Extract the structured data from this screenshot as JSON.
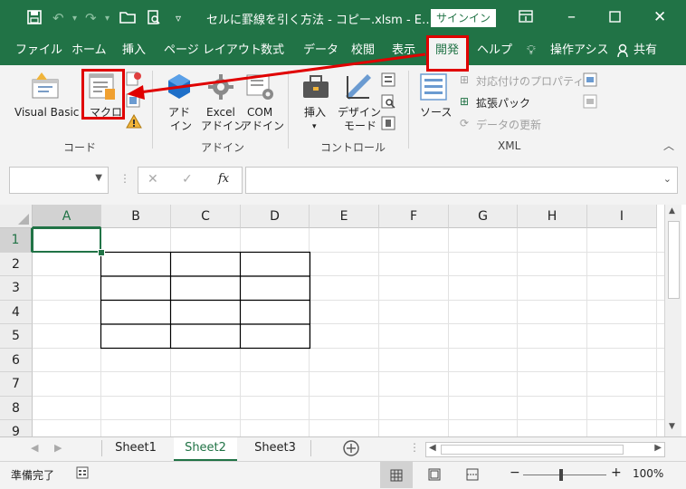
{
  "titlebar": {
    "title": "セルに罫線を引く方法 - コピー.xlsm  -  E…",
    "signin_label": "サインイン"
  },
  "tabs": [
    {
      "label": "ファイル"
    },
    {
      "label": "ホーム"
    },
    {
      "label": "挿入"
    },
    {
      "label": "ページ レイアウト"
    },
    {
      "label": "数式"
    },
    {
      "label": "データ"
    },
    {
      "label": "校閲"
    },
    {
      "label": "表示"
    },
    {
      "label": "開発"
    },
    {
      "label": "ヘルプ"
    }
  ],
  "tellme": "操作アシス",
  "share": "共有",
  "ribbon": {
    "code": {
      "label": "コード",
      "visual_basic": "Visual Basic",
      "macro": "マクロ"
    },
    "addins": {
      "label": "アドイン",
      "addin_1": "アド",
      "addin_2": "イン",
      "excel_1": "Excel",
      "excel_2": "アドイン",
      "com_1": "COM",
      "com_2": "アドイン"
    },
    "controls": {
      "label": "コントロール",
      "insert": "挿入",
      "design_1": "デザイン",
      "design_2": "モード"
    },
    "xml": {
      "label": "XML",
      "source": "ソース",
      "map_properties": "対応付けのプロパティ",
      "expansion_pack": "拡張パック",
      "refresh_data": "データの更新"
    }
  },
  "formula": {
    "fx": "fx"
  },
  "grid": {
    "columns": [
      "A",
      "B",
      "C",
      "D",
      "E",
      "F",
      "G",
      "H",
      "I"
    ],
    "rows": [
      "1",
      "2",
      "3",
      "4",
      "5",
      "6",
      "7",
      "8",
      "9"
    ]
  },
  "sheets": [
    {
      "label": "Sheet1"
    },
    {
      "label": "Sheet2"
    },
    {
      "label": "Sheet3"
    }
  ],
  "status": {
    "ready": "準備完了",
    "zoom": "100%"
  },
  "colors": {
    "accent": "#217346",
    "highlight": "#e00000"
  }
}
